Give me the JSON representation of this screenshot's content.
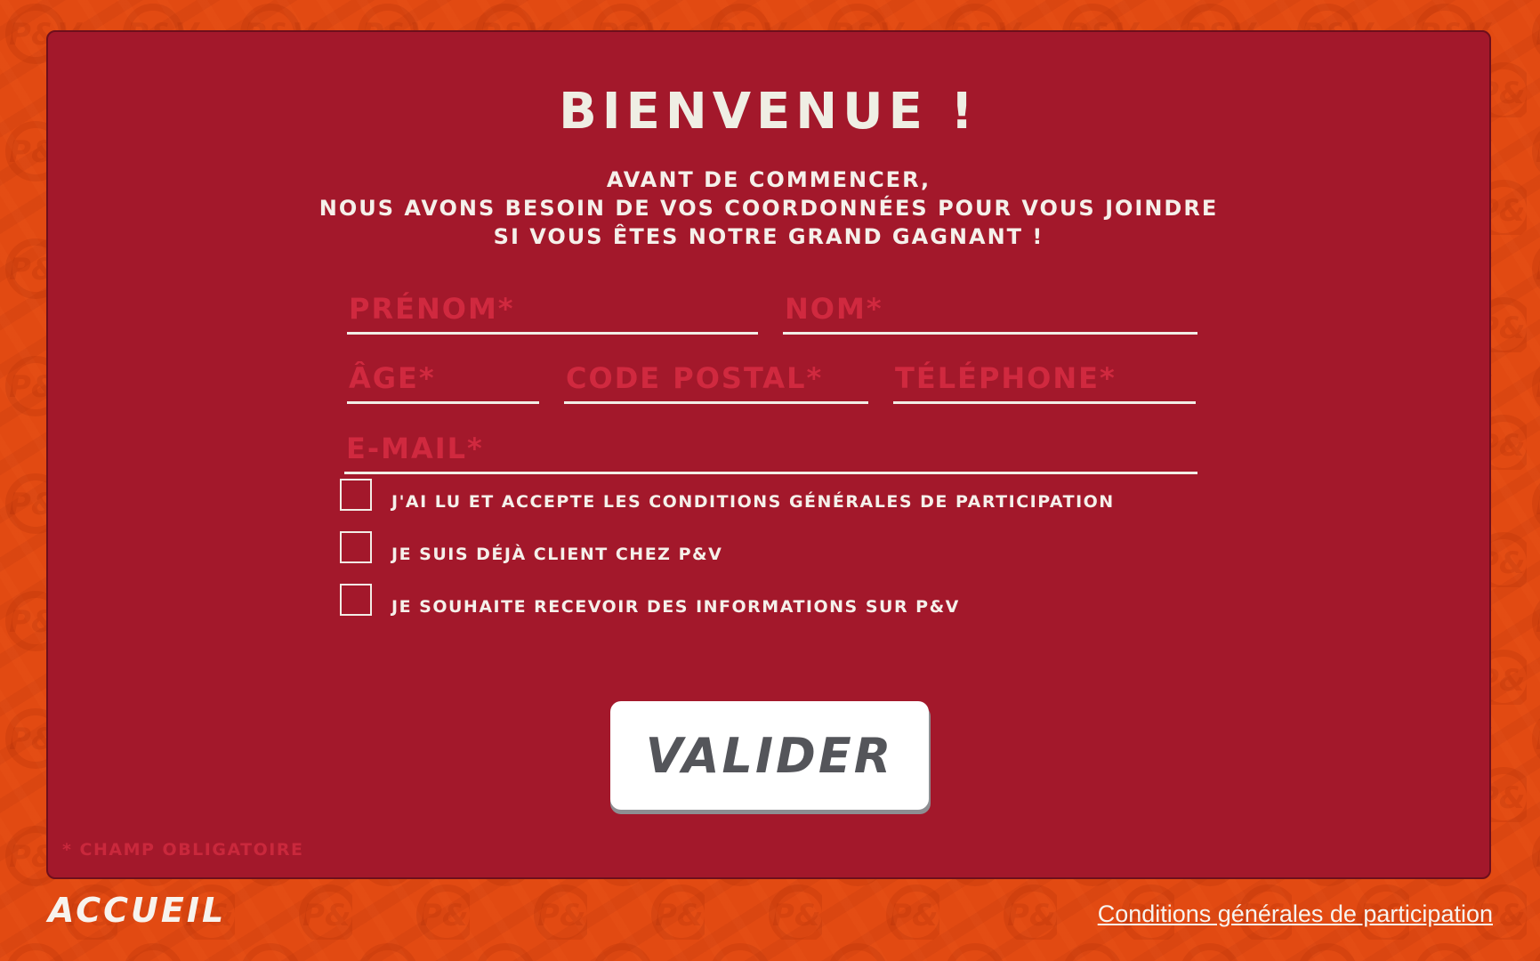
{
  "theme": {
    "background": "#e24a12",
    "panel": "#a3182b",
    "placeholder": "#d0293f",
    "text": "#f5f0ea",
    "button_text": "#54555a"
  },
  "background": {
    "watermark_text": "P&V"
  },
  "header": {
    "title": "BIENVENUE !",
    "intro_lines": [
      "AVANT DE COMMENCER,",
      "NOUS AVONS BESOIN DE VOS COORDONNÉES POUR VOUS JOINDRE",
      "SI VOUS ÊTES NOTRE GRAND GAGNANT !"
    ]
  },
  "form": {
    "fields": {
      "firstname": {
        "placeholder": "PRÉNOM*",
        "value": ""
      },
      "lastname": {
        "placeholder": "NOM*",
        "value": ""
      },
      "age": {
        "placeholder": "ÂGE*",
        "value": ""
      },
      "postal_code": {
        "placeholder": "CODE POSTAL*",
        "value": ""
      },
      "phone": {
        "placeholder": "TÉLÉPHONE*",
        "value": ""
      },
      "email": {
        "placeholder": "E-MAIL*",
        "value": ""
      }
    },
    "checkboxes": [
      {
        "label": "J'AI LU ET ACCEPTE LES CONDITIONS GÉNÉRALES DE PARTICIPATION",
        "checked": false
      },
      {
        "label": "JE SUIS DÉJÀ CLIENT CHEZ P&V",
        "checked": false
      },
      {
        "label": "JE SOUHAITE RECEVOIR DES INFORMATIONS SUR P&V",
        "checked": false
      }
    ],
    "submit_label": "VALIDER",
    "required_note": "* CHAMP OBLIGATOIRE"
  },
  "footer": {
    "home_label": "ACCUEIL",
    "terms_link": "Conditions générales de participation"
  }
}
